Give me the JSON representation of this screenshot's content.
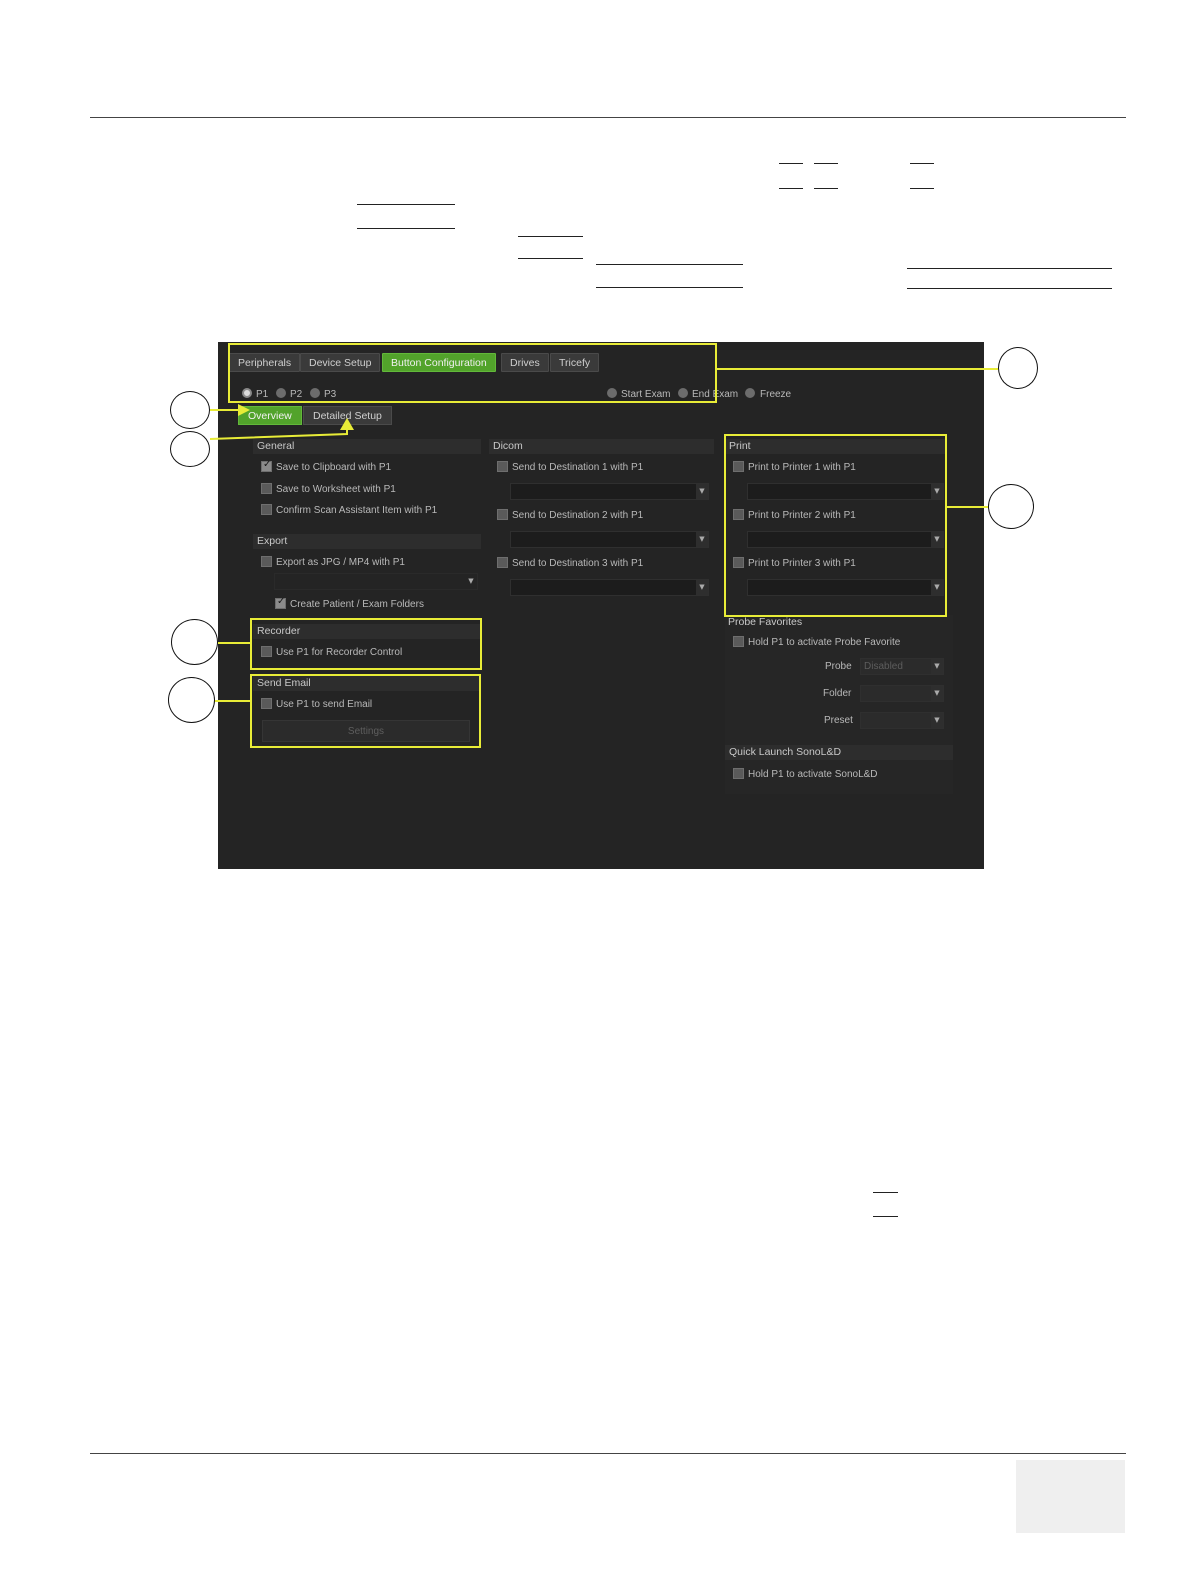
{
  "tabs": [
    {
      "label": "Peripherals"
    },
    {
      "label": "Device Setup"
    },
    {
      "label": "Button Configuration",
      "active": true
    },
    {
      "label": "Drives"
    },
    {
      "label": "Tricefy"
    }
  ],
  "buttons": [
    {
      "label": "P1",
      "selected": true
    },
    {
      "label": "P2",
      "selected": false
    },
    {
      "label": "P3",
      "selected": false
    }
  ],
  "modes": [
    {
      "label": "Start Exam"
    },
    {
      "label": "End Exam"
    },
    {
      "label": "Freeze"
    }
  ],
  "subtabs": [
    {
      "label": "Overview",
      "active": true
    },
    {
      "label": "Detailed Setup"
    }
  ],
  "general": {
    "title": "General",
    "items": [
      {
        "label": "Save to Clipboard with P1",
        "checked": true
      },
      {
        "label": "Save to Worksheet with P1",
        "checked": false
      },
      {
        "label": "Confirm Scan Assistant Item with P1",
        "checked": false
      }
    ]
  },
  "export": {
    "title": "Export",
    "item": {
      "label": "Export as JPG / MP4 with P1",
      "checked": false
    },
    "folders": {
      "label": "Create Patient / Exam Folders",
      "checked": true
    }
  },
  "recorder": {
    "title": "Recorder",
    "item": {
      "label": "Use P1 for Recorder Control",
      "checked": false
    }
  },
  "email": {
    "title": "Send Email",
    "item": {
      "label": "Use P1 to send Email",
      "checked": false
    },
    "settings_label": "Settings"
  },
  "dicom": {
    "title": "Dicom",
    "items": [
      {
        "label": "Send to Destination 1 with P1",
        "checked": false
      },
      {
        "label": "Send to Destination 2 with P1",
        "checked": false
      },
      {
        "label": "Send to Destination 3 with P1",
        "checked": false
      }
    ]
  },
  "print": {
    "title": "Print",
    "items": [
      {
        "label": "Print to Printer 1 with P1",
        "checked": false
      },
      {
        "label": "Print to Printer 2 with P1",
        "checked": false
      },
      {
        "label": "Print to Printer 3 with P1",
        "checked": false
      }
    ]
  },
  "probe_favorites": {
    "title": "Probe Favorites",
    "item": {
      "label": "Hold P1 to activate Probe Favorite",
      "checked": false
    },
    "probe_label": "Probe",
    "probe_value": "Disabled",
    "folder_label": "Folder",
    "preset_label": "Preset"
  },
  "quick_launch": {
    "title": "Quick Launch SonoL&D",
    "item": {
      "label": "Hold P1 to activate SonoL&D",
      "checked": false
    }
  },
  "colors": {
    "accent_green": "#52a32b",
    "highlight_yellow": "#e8ec37",
    "panel_dark": "#242424"
  }
}
